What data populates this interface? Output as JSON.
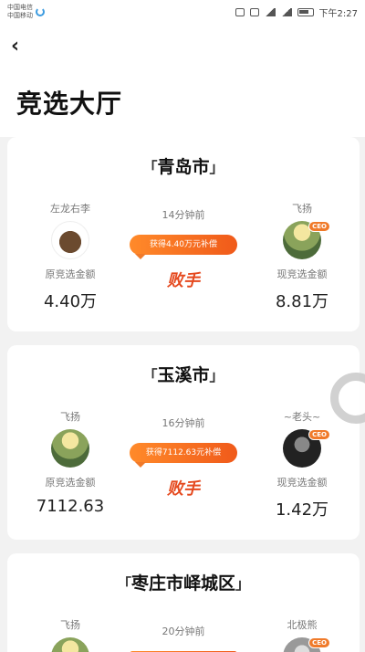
{
  "status_bar": {
    "carrier1": "中国电信",
    "carrier2": "中国移动",
    "time": "下午2:27"
  },
  "header": {
    "back_icon": "back-arrow-icon",
    "back_glyph": "‹",
    "title": "竞选大厅"
  },
  "cards": [
    {
      "city": "青岛市",
      "left": {
        "name": "左龙右李",
        "amount_label": "原竞选金额",
        "amount": "4.40万"
      },
      "time": "14分钟前",
      "subsidy": "获得4.40万元补偿",
      "loss": "败手",
      "right": {
        "name": "飞扬",
        "amount_label": "现竞选金额",
        "amount": "8.81万",
        "badge": "CEO"
      }
    },
    {
      "city": "玉溪市",
      "left": {
        "name": "飞扬",
        "amount_label": "原竞选金额",
        "amount": "7112.63"
      },
      "time": "16分钟前",
      "subsidy": "获得7112.63元补偿",
      "loss": "败手",
      "right": {
        "name": "~老头~",
        "amount_label": "现竞选金额",
        "amount": "1.42万",
        "badge": "CEO"
      }
    },
    {
      "city": "枣庄市峄城区",
      "left": {
        "name": "飞扬"
      },
      "time": "20分钟前",
      "right": {
        "name": "北极熊",
        "badge": "CEO"
      }
    }
  ],
  "colors": {
    "accent": "#f05a1a",
    "loss": "#e5491e",
    "background": "#f2f2f2"
  }
}
